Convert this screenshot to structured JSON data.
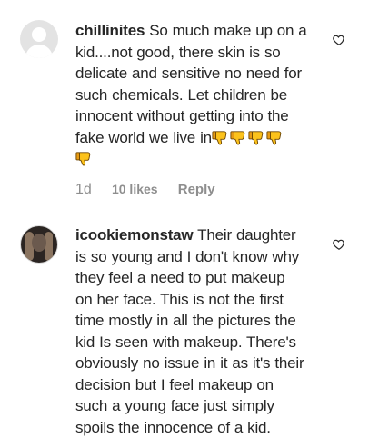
{
  "comments": [
    {
      "username": "chillinites",
      "text_lines": [
        " So much make up on a",
        "kid....not good, there skin is so",
        "delicate and sensitive no need for",
        "such chemicals. Let children be",
        "innocent without getting into the",
        "fake world we live in"
      ],
      "emoji": "thumbs-down-emoji",
      "emoji_count": 5,
      "time": "1d",
      "likes": "10 likes",
      "reply": "Reply"
    },
    {
      "username": "icookiemonstaw",
      "text_lines": [
        " Their daughter",
        "is so young and I don't know why",
        "they feel a need to put makeup",
        "on her face. This is not the first",
        "time mostly in all the pictures the",
        "kid Is seen with makeup. There's",
        "obviously no issue in it as it's their",
        "decision but I feel makeup on",
        "such a young face just simply",
        "spoils the innocence of a kid."
      ]
    }
  ]
}
